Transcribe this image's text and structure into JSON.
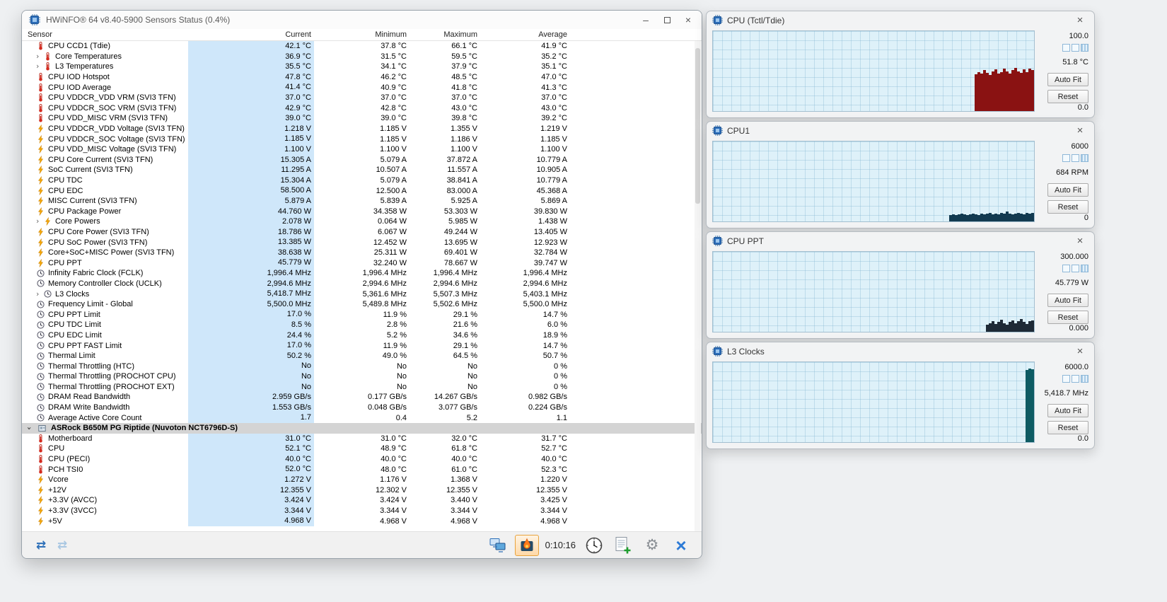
{
  "window": {
    "title": "HWiNFO® 64 v8.40-5900 Sensors Status (0.4%)"
  },
  "table": {
    "columns": [
      "Sensor",
      "Current",
      "Minimum",
      "Maximum",
      "Average"
    ],
    "current_column_highlight": "#cfe7fa",
    "rows": [
      {
        "icon": "temperature-icon",
        "label": "CPU CCD1 (Tdie)",
        "current": "42.1 °C",
        "min": "37.8 °C",
        "max": "66.1 °C",
        "avg": "41.9 °C"
      },
      {
        "icon": "temperature-icon",
        "expandable": true,
        "label": "Core Temperatures",
        "current": "36.9 °C",
        "min": "31.5 °C",
        "max": "59.5 °C",
        "avg": "35.2 °C"
      },
      {
        "icon": "temperature-icon",
        "expandable": true,
        "label": "L3 Temperatures",
        "current": "35.5 °C",
        "min": "34.1 °C",
        "max": "37.9 °C",
        "avg": "35.1 °C"
      },
      {
        "icon": "temperature-icon",
        "label": "CPU IOD Hotspot",
        "current": "47.8 °C",
        "min": "46.2 °C",
        "max": "48.5 °C",
        "avg": "47.0 °C"
      },
      {
        "icon": "temperature-icon",
        "label": "CPU IOD Average",
        "current": "41.4 °C",
        "min": "40.9 °C",
        "max": "41.8 °C",
        "avg": "41.3 °C"
      },
      {
        "icon": "temperature-icon",
        "label": "CPU VDDCR_VDD VRM (SVI3 TFN)",
        "current": "37.0 °C",
        "min": "37.0 °C",
        "max": "37.0 °C",
        "avg": "37.0 °C"
      },
      {
        "icon": "temperature-icon",
        "label": "CPU VDDCR_SOC VRM (SVI3 TFN)",
        "current": "42.9 °C",
        "min": "42.8 °C",
        "max": "43.0 °C",
        "avg": "43.0 °C"
      },
      {
        "icon": "temperature-icon",
        "label": "CPU VDD_MISC VRM (SVI3 TFN)",
        "current": "39.0 °C",
        "min": "39.0 °C",
        "max": "39.8 °C",
        "avg": "39.2 °C"
      },
      {
        "icon": "power-icon",
        "label": "CPU VDDCR_VDD Voltage (SVI3 TFN)",
        "current": "1.218 V",
        "min": "1.185 V",
        "max": "1.355 V",
        "avg": "1.219 V"
      },
      {
        "icon": "power-icon",
        "label": "CPU VDDCR_SOC Voltage (SVI3 TFN)",
        "current": "1.185 V",
        "min": "1.185 V",
        "max": "1.186 V",
        "avg": "1.185 V"
      },
      {
        "icon": "power-icon",
        "label": "CPU VDD_MISC Voltage (SVI3 TFN)",
        "current": "1.100 V",
        "min": "1.100 V",
        "max": "1.100 V",
        "avg": "1.100 V"
      },
      {
        "icon": "power-icon",
        "label": "CPU Core Current (SVI3 TFN)",
        "current": "15.305 A",
        "min": "5.079 A",
        "max": "37.872 A",
        "avg": "10.779 A"
      },
      {
        "icon": "power-icon",
        "label": "SoC Current (SVI3 TFN)",
        "current": "11.295 A",
        "min": "10.507 A",
        "max": "11.557 A",
        "avg": "10.905 A"
      },
      {
        "icon": "power-icon",
        "label": "CPU TDC",
        "current": "15.304 A",
        "min": "5.079 A",
        "max": "38.841 A",
        "avg": "10.779 A"
      },
      {
        "icon": "power-icon",
        "label": "CPU EDC",
        "current": "58.500 A",
        "min": "12.500 A",
        "max": "83.000 A",
        "avg": "45.368 A"
      },
      {
        "icon": "power-icon",
        "label": "MISC Current (SVI3 TFN)",
        "current": "5.879 A",
        "min": "5.839 A",
        "max": "5.925 A",
        "avg": "5.869 A"
      },
      {
        "icon": "power-icon",
        "label": "CPU Package Power",
        "current": "44.760 W",
        "min": "34.358 W",
        "max": "53.303 W",
        "avg": "39.830 W"
      },
      {
        "icon": "power-icon",
        "expandable": true,
        "label": "Core Powers",
        "current": "2.078 W",
        "min": "0.064 W",
        "max": "5.985 W",
        "avg": "1.438 W"
      },
      {
        "icon": "power-icon",
        "label": "CPU Core Power (SVI3 TFN)",
        "current": "18.786 W",
        "min": "6.067 W",
        "max": "49.244 W",
        "avg": "13.405 W"
      },
      {
        "icon": "power-icon",
        "label": "CPU SoC Power (SVI3 TFN)",
        "current": "13.385 W",
        "min": "12.452 W",
        "max": "13.695 W",
        "avg": "12.923 W"
      },
      {
        "icon": "power-icon",
        "label": "Core+SoC+MISC Power (SVI3 TFN)",
        "current": "38.638 W",
        "min": "25.311 W",
        "max": "69.401 W",
        "avg": "32.784 W"
      },
      {
        "icon": "power-icon",
        "label": "CPU PPT",
        "current": "45.779 W",
        "min": "32.240 W",
        "max": "78.667 W",
        "avg": "39.747 W"
      },
      {
        "icon": "clock-icon",
        "label": "Infinity Fabric Clock (FCLK)",
        "current": "1,996.4 MHz",
        "min": "1,996.4 MHz",
        "max": "1,996.4 MHz",
        "avg": "1,996.4 MHz"
      },
      {
        "icon": "clock-icon",
        "label": "Memory Controller Clock (UCLK)",
        "current": "2,994.6 MHz",
        "min": "2,994.6 MHz",
        "max": "2,994.6 MHz",
        "avg": "2,994.6 MHz"
      },
      {
        "icon": "clock-icon",
        "expandable": true,
        "label": "L3 Clocks",
        "current": "5,418.7 MHz",
        "min": "5,361.6 MHz",
        "max": "5,507.3 MHz",
        "avg": "5,403.1 MHz"
      },
      {
        "icon": "clock-icon",
        "label": "Frequency Limit - Global",
        "current": "5,500.0 MHz",
        "min": "5,489.8 MHz",
        "max": "5,502.6 MHz",
        "avg": "5,500.0 MHz"
      },
      {
        "icon": "clock-icon",
        "label": "CPU PPT Limit",
        "current": "17.0 %",
        "min": "11.9 %",
        "max": "29.1 %",
        "avg": "14.7 %"
      },
      {
        "icon": "clock-icon",
        "label": "CPU TDC Limit",
        "current": "8.5 %",
        "min": "2.8 %",
        "max": "21.6 %",
        "avg": "6.0 %"
      },
      {
        "icon": "clock-icon",
        "label": "CPU EDC Limit",
        "current": "24.4 %",
        "min": "5.2 %",
        "max": "34.6 %",
        "avg": "18.9 %"
      },
      {
        "icon": "clock-icon",
        "label": "CPU PPT FAST Limit",
        "current": "17.0 %",
        "min": "11.9 %",
        "max": "29.1 %",
        "avg": "14.7 %"
      },
      {
        "icon": "clock-icon",
        "label": "Thermal Limit",
        "current": "50.2 %",
        "min": "49.0 %",
        "max": "64.5 %",
        "avg": "50.7 %"
      },
      {
        "icon": "clock-icon",
        "label": "Thermal Throttling (HTC)",
        "current": "No",
        "min": "No",
        "max": "No",
        "avg": "0 %"
      },
      {
        "icon": "clock-icon",
        "label": "Thermal Throttling (PROCHOT CPU)",
        "current": "No",
        "min": "No",
        "max": "No",
        "avg": "0 %"
      },
      {
        "icon": "clock-icon",
        "label": "Thermal Throttling (PROCHOT EXT)",
        "current": "No",
        "min": "No",
        "max": "No",
        "avg": "0 %"
      },
      {
        "icon": "clock-icon",
        "label": "DRAM Read Bandwidth",
        "current": "2.959 GB/s",
        "min": "0.177 GB/s",
        "max": "14.267 GB/s",
        "avg": "0.982 GB/s"
      },
      {
        "icon": "clock-icon",
        "label": "DRAM Write Bandwidth",
        "current": "1.553 GB/s",
        "min": "0.048 GB/s",
        "max": "3.077 GB/s",
        "avg": "0.224 GB/s"
      },
      {
        "icon": "clock-icon",
        "label": "Average Active Core Count",
        "current": "1.7",
        "min": "0.4",
        "max": "5.2",
        "avg": "1.1"
      },
      {
        "type": "section",
        "icon": "board-icon",
        "label": "ASRock B650M PG Riptide (Nuvoton NCT6796D-S)"
      },
      {
        "icon": "temperature-icon",
        "label": "Motherboard",
        "current": "31.0 °C",
        "min": "31.0 °C",
        "max": "32.0 °C",
        "avg": "31.7 °C"
      },
      {
        "icon": "temperature-icon",
        "label": "CPU",
        "current": "52.1 °C",
        "min": "48.9 °C",
        "max": "61.8 °C",
        "avg": "52.7 °C"
      },
      {
        "icon": "temperature-icon",
        "label": "CPU (PECI)",
        "current": "40.0 °C",
        "min": "40.0 °C",
        "max": "40.0 °C",
        "avg": "40.0 °C"
      },
      {
        "icon": "temperature-icon",
        "label": "PCH TSI0",
        "current": "52.0 °C",
        "min": "48.0 °C",
        "max": "61.0 °C",
        "avg": "52.3 °C"
      },
      {
        "icon": "power-icon",
        "label": "Vcore",
        "current": "1.272 V",
        "min": "1.176 V",
        "max": "1.368 V",
        "avg": "1.220 V"
      },
      {
        "icon": "power-icon",
        "label": "+12V",
        "current": "12.355 V",
        "min": "12.302 V",
        "max": "12.355 V",
        "avg": "12.355 V"
      },
      {
        "icon": "power-icon",
        "label": "+3.3V (AVCC)",
        "current": "3.424 V",
        "min": "3.424 V",
        "max": "3.440 V",
        "avg": "3.425 V"
      },
      {
        "icon": "power-icon",
        "label": "+3.3V (3VCC)",
        "current": "3.344 V",
        "min": "3.344 V",
        "max": "3.344 V",
        "avg": "3.344 V"
      },
      {
        "icon": "power-icon",
        "label": "+5V",
        "current": "4.968 V",
        "min": "4.968 V",
        "max": "4.968 V",
        "avg": "4.968 V"
      }
    ]
  },
  "toolbar": {
    "time": "0:10:16",
    "icons": [
      "swap-arrows-icon",
      "remote-monitors-icon",
      "sensors-flame-icon",
      "clock-icon",
      "report-icon",
      "settings-gear-icon",
      "exit-x-icon"
    ]
  },
  "graph_buttons": {
    "auto_fit": "Auto Fit",
    "reset": "Reset"
  },
  "graphs": [
    {
      "title": "CPU (Tctl/Tdie)",
      "max_label": "100.0",
      "value": "51.8 °C",
      "min_label": "0.0",
      "bar_color": "#8a1212",
      "bars": [
        46,
        49,
        47,
        51,
        48,
        45,
        50,
        52,
        47,
        49,
        53,
        50,
        47,
        51,
        54,
        50,
        48,
        52,
        49,
        53,
        51
      ]
    },
    {
      "title": "CPU1",
      "max_label": "6000",
      "value": "684 RPM",
      "min_label": "0",
      "bar_color": "#123a50",
      "bars": [
        8,
        9,
        8,
        9,
        10,
        9,
        8,
        9,
        10,
        9,
        8,
        10,
        9,
        10,
        11,
        9,
        10,
        9,
        11,
        10,
        12,
        10,
        9,
        10,
        11,
        10,
        9,
        11,
        10,
        11
      ]
    },
    {
      "title": "CPU PPT",
      "max_label": "300.000",
      "value": "45.779 W",
      "min_label": "0.000",
      "bar_color": "#1e2a36",
      "bars": [
        9,
        11,
        13,
        10,
        12,
        15,
        11,
        9,
        12,
        14,
        11,
        13,
        16,
        12,
        10,
        13,
        14
      ]
    },
    {
      "title": "L3 Clocks",
      "max_label": "6000.0",
      "value": "5,418.7 MHz",
      "min_label": "0.0",
      "bar_color": "#0e5b63",
      "bars": [
        90,
        92,
        91
      ]
    }
  ]
}
